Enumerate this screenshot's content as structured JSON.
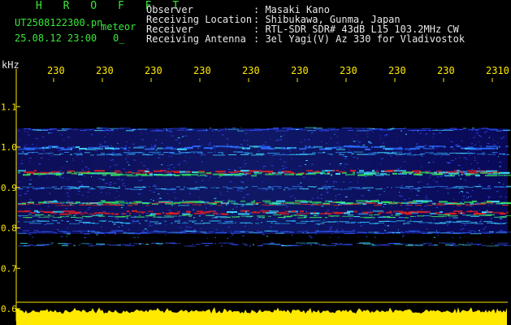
{
  "header": {
    "app_title": "H R O F F T",
    "filename": "UT2508122300.pn",
    "mode": "meteor",
    "datetime": "25.08.12 23:00",
    "count": "0_",
    "fields": [
      {
        "label": "Observer",
        "value": ":  Masaki Kano"
      },
      {
        "label": "Receiving Location",
        "value": ":  Shibukawa, Gunma, Japan"
      },
      {
        "label": "Receiver",
        "value": ":  RTL-SDR SDR# 43dB L15 103.2MHz CW"
      },
      {
        "label": "Receiving Antenna",
        "value": ":  3el Yagi(V) Az 330 for Vladivostok"
      }
    ]
  },
  "spectrogram": {
    "y_unit": "kHz",
    "y_ticks": [
      "1.1",
      "1.0",
      "0.9",
      "0.8",
      "0.7",
      "0.6"
    ],
    "y_tick_values": [
      1.1,
      1.0,
      0.9,
      0.8,
      0.7,
      0.6
    ],
    "time_ticks": [
      "230",
      "230",
      "230",
      "230",
      "230",
      "230",
      "230",
      "230",
      "230",
      "2310"
    ],
    "colors": {
      "axis": "#ffe900",
      "text_green": "#39e639",
      "text_white": "#e8e8e8",
      "background_signal": "#1a1aa8",
      "strong_signal": "#e02020",
      "power_trace": "#ffe900"
    }
  }
}
